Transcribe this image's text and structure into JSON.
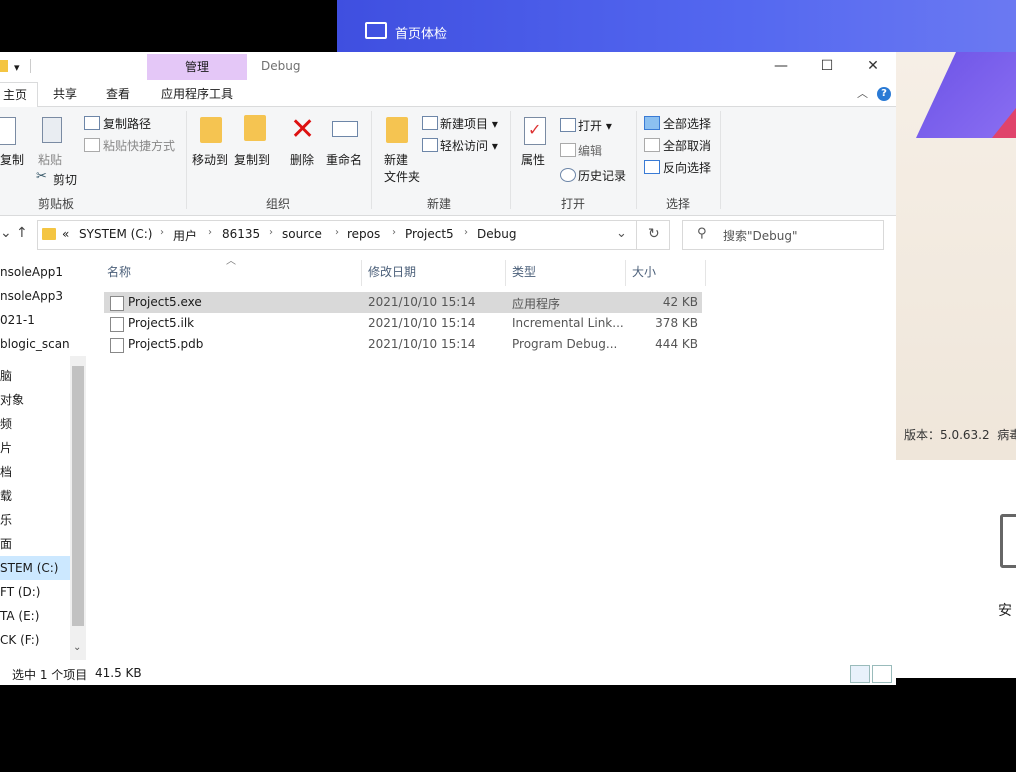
{
  "background_app": {
    "title": "首页体检",
    "version": "版本：5.0.63.2",
    "version_suffix": "病毒",
    "safe_label": "安"
  },
  "window": {
    "title": "Debug",
    "contextual_tab": "管理",
    "controls": {
      "minimize": "—",
      "maximize": "☐",
      "close": "✕"
    }
  },
  "tabs": [
    {
      "label": "主页",
      "active": true
    },
    {
      "label": "共享",
      "active": false
    },
    {
      "label": "查看",
      "active": false
    },
    {
      "label": "应用程序工具",
      "active": false
    }
  ],
  "ribbon": {
    "clipboard": {
      "group": "剪贴板",
      "copy": "复制",
      "paste": "粘贴",
      "copy_path": "复制路径",
      "paste_shortcut": "粘贴快捷方式",
      "cut": "剪切"
    },
    "organize": {
      "group": "组织",
      "move_to": "移动到",
      "copy_to": "复制到",
      "delete": "删除",
      "rename": "重命名"
    },
    "new": {
      "group": "新建",
      "new_folder_line1": "新建",
      "new_folder_line2": "文件夹",
      "new_item": "新建项目",
      "easy_access": "轻松访问"
    },
    "open": {
      "group": "打开",
      "properties": "属性",
      "open": "打开",
      "edit": "编辑",
      "history": "历史记录"
    },
    "select": {
      "group": "选择",
      "select_all": "全部选择",
      "select_none": "全部取消",
      "invert": "反向选择"
    }
  },
  "address": {
    "prefix": "«",
    "crumbs": [
      "SYSTEM (C:)",
      "用户",
      "86135",
      "source",
      "repos",
      "Project5",
      "Debug"
    ]
  },
  "search": {
    "placeholder": "搜索\"Debug\""
  },
  "nav": {
    "items": [
      {
        "label": "nsoleApp1"
      },
      {
        "label": "nsoleApp3"
      },
      {
        "label": "021-1"
      },
      {
        "label": "blogic_scan"
      },
      {
        "label": "脑"
      },
      {
        "label": " 对象"
      },
      {
        "label": "频"
      },
      {
        "label": "片"
      },
      {
        "label": "档"
      },
      {
        "label": "载"
      },
      {
        "label": "乐"
      },
      {
        "label": "面"
      },
      {
        "label": "STEM (C:)",
        "selected": true
      },
      {
        "label": "FT (D:)"
      },
      {
        "label": "TA (E:)"
      },
      {
        "label": "CK (F:)"
      }
    ]
  },
  "columns": {
    "name": "名称",
    "date": "修改日期",
    "type": "类型",
    "size": "大小"
  },
  "files": [
    {
      "name": "Project5.exe",
      "date": "2021/10/10 15:14",
      "type": "应用程序",
      "size": "42 KB",
      "selected": true
    },
    {
      "name": "Project5.ilk",
      "date": "2021/10/10 15:14",
      "type": "Incremental Link...",
      "size": "378 KB",
      "selected": false
    },
    {
      "name": "Project5.pdb",
      "date": "2021/10/10 15:14",
      "type": "Program Debug...",
      "size": "444 KB",
      "selected": false
    }
  ],
  "status": {
    "selection": "选中 1 个项目",
    "size": "41.5 KB"
  }
}
